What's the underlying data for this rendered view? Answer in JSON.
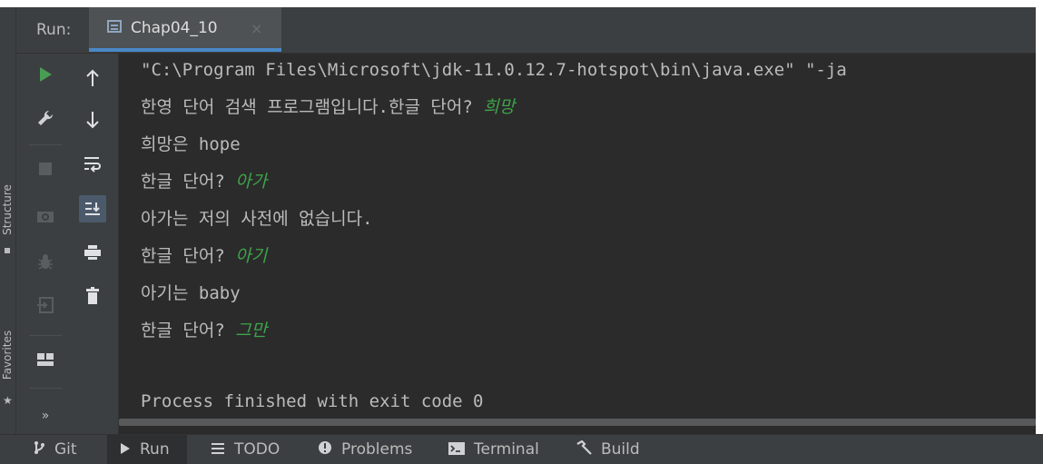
{
  "side_labels": {
    "structure": "Structure",
    "favorites": "Favorites"
  },
  "run_panel": {
    "label": "Run:",
    "tab_title": "Chap04_10",
    "tab_close": "×"
  },
  "console": {
    "lines": [
      {
        "text": "\"C:\\Program Files\\Microsoft\\jdk-11.0.12.7-hotspot\\bin\\java.exe\" \"-ja",
        "input": ""
      },
      {
        "text": "한영 단어 검색 프로그램입니다.한글 단어? ",
        "input": "희망"
      },
      {
        "text": "희망은 hope",
        "input": ""
      },
      {
        "text": "한글 단어? ",
        "input": "아가"
      },
      {
        "text": "아가는 저의 사전에 없습니다.",
        "input": ""
      },
      {
        "text": "한글 단어? ",
        "input": "아기"
      },
      {
        "text": "아기는 baby",
        "input": ""
      },
      {
        "text": "한글 단어? ",
        "input": "그만"
      },
      {
        "text": "",
        "input": ""
      },
      {
        "text": "Process finished with exit code 0",
        "input": ""
      }
    ]
  },
  "bottom_tabs": [
    {
      "label": "Git",
      "icon": "git-icon"
    },
    {
      "label": "Run",
      "icon": "run-icon",
      "active": true
    },
    {
      "label": "TODO",
      "icon": "todo-icon"
    },
    {
      "label": "Problems",
      "icon": "problems-icon"
    },
    {
      "label": "Terminal",
      "icon": "terminal-icon"
    },
    {
      "label": "Build",
      "icon": "build-icon"
    }
  ],
  "colors": {
    "background": "#2b2b2b",
    "panel": "#3c3f41",
    "text": "#bbbbbb",
    "user_input": "#3ea34a",
    "run_green": "#499c54",
    "tab_underline": "#4a88c7"
  }
}
